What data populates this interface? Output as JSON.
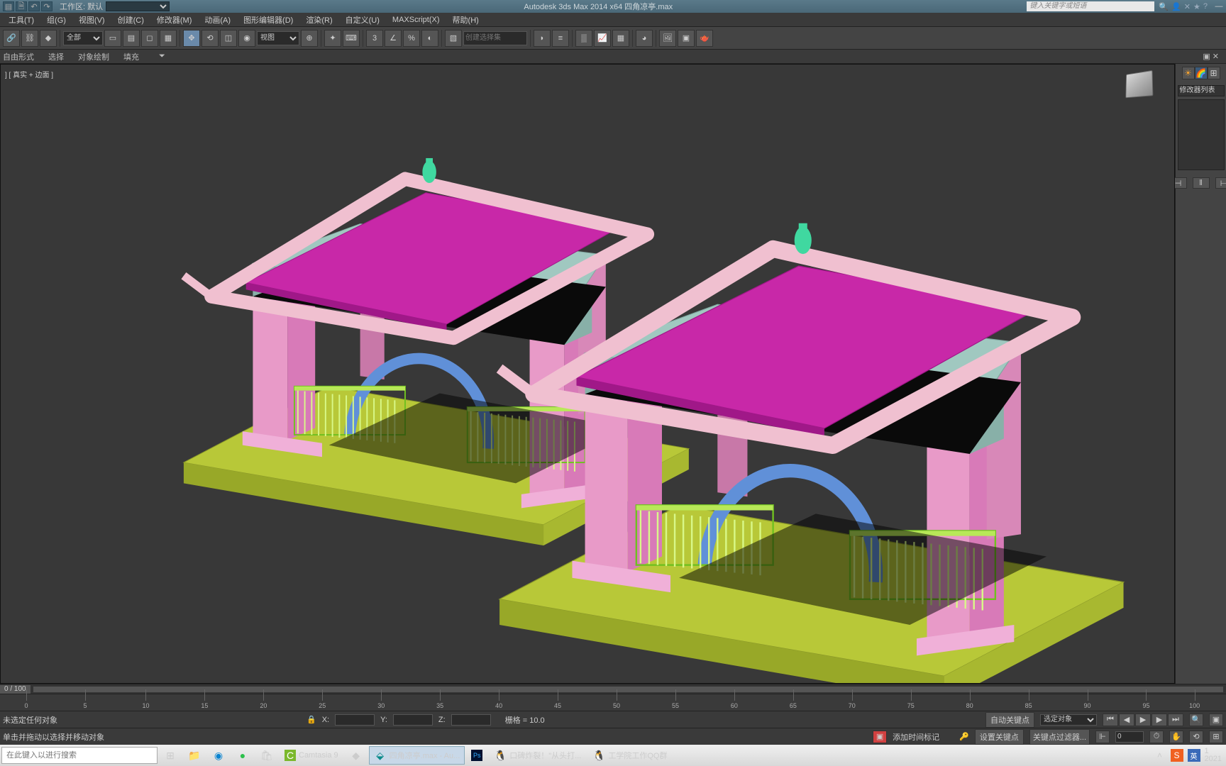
{
  "titlebar": {
    "workspace_label": "工作区: 默认",
    "app_title": "Autodesk 3ds Max  2014 x64    四角凉亭.max",
    "search_placeholder": "键入关键字或短语"
  },
  "menus": [
    "工具(T)",
    "组(G)",
    "视图(V)",
    "创建(C)",
    "修改器(M)",
    "动画(A)",
    "图形编辑器(D)",
    "渲染(R)",
    "自定义(U)",
    "MAXScript(X)",
    "帮助(H)"
  ],
  "toolbar": {
    "filter_all": "全部",
    "view_label": "视图",
    "selection_set": "创建选择集"
  },
  "ribbon": {
    "items": [
      "自由形式",
      "选择",
      "对象绘制",
      "填充"
    ]
  },
  "viewport": {
    "label": "] [ 真实 + 边面 ]"
  },
  "right_panel": {
    "dropdown": "修改器列表"
  },
  "timeline": {
    "frame": "0 / 100",
    "ticks": [
      0,
      5,
      10,
      15,
      20,
      25,
      30,
      35,
      40,
      45,
      50,
      55,
      60,
      65,
      70,
      75,
      80,
      85,
      90,
      95,
      100
    ]
  },
  "status": {
    "sel_none": "未选定任何对象",
    "prompt": "单击并拖动以选择并移动对象",
    "x_label": "X:",
    "y_label": "Y:",
    "z_label": "Z:",
    "grid": "栅格 = 10.0",
    "add_time_tag": "添加时间标记",
    "auto_key": "自动关键点",
    "set_key": "设置关键点",
    "sel_obj_dd": "选定对象",
    "key_filter": "关键点过滤器...",
    "frame_spin": "0"
  },
  "taskbar": {
    "search_placeholder": "在此键入以进行搜索",
    "items": [
      {
        "label": ""
      },
      {
        "label": ""
      },
      {
        "label": ""
      },
      {
        "label": ""
      },
      {
        "label": "Camtasia 9"
      },
      {
        "label": ""
      },
      {
        "label": "四角凉亭.max - Au...",
        "active": true
      },
      {
        "label": ""
      },
      {
        "label": "口碑炸裂！\"从头打..."
      },
      {
        "label": "工学院工作QQ群"
      }
    ],
    "time1": "1",
    "time2": "2021"
  }
}
